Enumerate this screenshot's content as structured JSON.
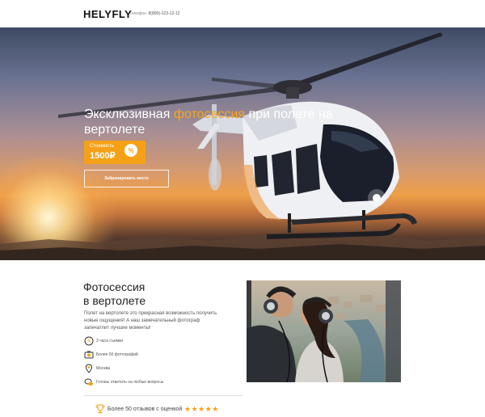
{
  "header": {
    "logo": "HELYFLY",
    "phone_label": "Телефон:",
    "phone_number": "8(800)-123-12-12"
  },
  "hero": {
    "title_part1": "Эксклюзивная ",
    "title_accent": "фотосессия",
    "title_part2": " при полете на вертолете",
    "price_label": "Стоимость",
    "price_value": "1500₽",
    "discount_symbol": "%",
    "book_button": "Забронировать место",
    "accent_color": "#f5a117"
  },
  "about": {
    "title_line1": "Фотосессия",
    "title_line2": "в вертолете",
    "description": "Полет на вертолете это прекрасная возможность получить новые ощущения! А наш замечательный фотограф запечатлит лучшие моменты!",
    "features": [
      {
        "icon": "clock-icon",
        "text": "3 часа съемки"
      },
      {
        "icon": "camera-icon",
        "text": "Более 50 фотографий"
      },
      {
        "icon": "location-pin-icon",
        "text": "Москва"
      },
      {
        "icon": "chat-bubbles-icon",
        "text": "Готовы ответить на любые вопросы"
      }
    ],
    "reviews_text": "Более 50 отзывов с оценкой",
    "rating_stars": 5
  }
}
